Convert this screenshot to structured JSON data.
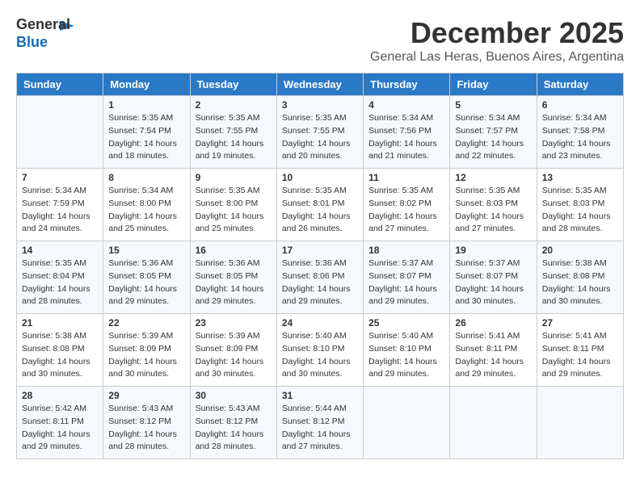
{
  "header": {
    "logo_line1": "General",
    "logo_line2": "Blue",
    "month": "December 2025",
    "location": "General Las Heras, Buenos Aires, Argentina"
  },
  "days_of_week": [
    "Sunday",
    "Monday",
    "Tuesday",
    "Wednesday",
    "Thursday",
    "Friday",
    "Saturday"
  ],
  "weeks": [
    [
      {
        "day": "",
        "content": ""
      },
      {
        "day": "1",
        "content": "Sunrise: 5:35 AM\nSunset: 7:54 PM\nDaylight: 14 hours\nand 18 minutes."
      },
      {
        "day": "2",
        "content": "Sunrise: 5:35 AM\nSunset: 7:55 PM\nDaylight: 14 hours\nand 19 minutes."
      },
      {
        "day": "3",
        "content": "Sunrise: 5:35 AM\nSunset: 7:55 PM\nDaylight: 14 hours\nand 20 minutes."
      },
      {
        "day": "4",
        "content": "Sunrise: 5:34 AM\nSunset: 7:56 PM\nDaylight: 14 hours\nand 21 minutes."
      },
      {
        "day": "5",
        "content": "Sunrise: 5:34 AM\nSunset: 7:57 PM\nDaylight: 14 hours\nand 22 minutes."
      },
      {
        "day": "6",
        "content": "Sunrise: 5:34 AM\nSunset: 7:58 PM\nDaylight: 14 hours\nand 23 minutes."
      }
    ],
    [
      {
        "day": "7",
        "content": "Sunrise: 5:34 AM\nSunset: 7:59 PM\nDaylight: 14 hours\nand 24 minutes."
      },
      {
        "day": "8",
        "content": "Sunrise: 5:34 AM\nSunset: 8:00 PM\nDaylight: 14 hours\nand 25 minutes."
      },
      {
        "day": "9",
        "content": "Sunrise: 5:35 AM\nSunset: 8:00 PM\nDaylight: 14 hours\nand 25 minutes."
      },
      {
        "day": "10",
        "content": "Sunrise: 5:35 AM\nSunset: 8:01 PM\nDaylight: 14 hours\nand 26 minutes."
      },
      {
        "day": "11",
        "content": "Sunrise: 5:35 AM\nSunset: 8:02 PM\nDaylight: 14 hours\nand 27 minutes."
      },
      {
        "day": "12",
        "content": "Sunrise: 5:35 AM\nSunset: 8:03 PM\nDaylight: 14 hours\nand 27 minutes."
      },
      {
        "day": "13",
        "content": "Sunrise: 5:35 AM\nSunset: 8:03 PM\nDaylight: 14 hours\nand 28 minutes."
      }
    ],
    [
      {
        "day": "14",
        "content": "Sunrise: 5:35 AM\nSunset: 8:04 PM\nDaylight: 14 hours\nand 28 minutes."
      },
      {
        "day": "15",
        "content": "Sunrise: 5:36 AM\nSunset: 8:05 PM\nDaylight: 14 hours\nand 29 minutes."
      },
      {
        "day": "16",
        "content": "Sunrise: 5:36 AM\nSunset: 8:05 PM\nDaylight: 14 hours\nand 29 minutes."
      },
      {
        "day": "17",
        "content": "Sunrise: 5:36 AM\nSunset: 8:06 PM\nDaylight: 14 hours\nand 29 minutes."
      },
      {
        "day": "18",
        "content": "Sunrise: 5:37 AM\nSunset: 8:07 PM\nDaylight: 14 hours\nand 29 minutes."
      },
      {
        "day": "19",
        "content": "Sunrise: 5:37 AM\nSunset: 8:07 PM\nDaylight: 14 hours\nand 30 minutes."
      },
      {
        "day": "20",
        "content": "Sunrise: 5:38 AM\nSunset: 8:08 PM\nDaylight: 14 hours\nand 30 minutes."
      }
    ],
    [
      {
        "day": "21",
        "content": "Sunrise: 5:38 AM\nSunset: 8:08 PM\nDaylight: 14 hours\nand 30 minutes."
      },
      {
        "day": "22",
        "content": "Sunrise: 5:39 AM\nSunset: 8:09 PM\nDaylight: 14 hours\nand 30 minutes."
      },
      {
        "day": "23",
        "content": "Sunrise: 5:39 AM\nSunset: 8:09 PM\nDaylight: 14 hours\nand 30 minutes."
      },
      {
        "day": "24",
        "content": "Sunrise: 5:40 AM\nSunset: 8:10 PM\nDaylight: 14 hours\nand 30 minutes."
      },
      {
        "day": "25",
        "content": "Sunrise: 5:40 AM\nSunset: 8:10 PM\nDaylight: 14 hours\nand 29 minutes."
      },
      {
        "day": "26",
        "content": "Sunrise: 5:41 AM\nSunset: 8:11 PM\nDaylight: 14 hours\nand 29 minutes."
      },
      {
        "day": "27",
        "content": "Sunrise: 5:41 AM\nSunset: 8:11 PM\nDaylight: 14 hours\nand 29 minutes."
      }
    ],
    [
      {
        "day": "28",
        "content": "Sunrise: 5:42 AM\nSunset: 8:11 PM\nDaylight: 14 hours\nand 29 minutes."
      },
      {
        "day": "29",
        "content": "Sunrise: 5:43 AM\nSunset: 8:12 PM\nDaylight: 14 hours\nand 28 minutes."
      },
      {
        "day": "30",
        "content": "Sunrise: 5:43 AM\nSunset: 8:12 PM\nDaylight: 14 hours\nand 28 minutes."
      },
      {
        "day": "31",
        "content": "Sunrise: 5:44 AM\nSunset: 8:12 PM\nDaylight: 14 hours\nand 27 minutes."
      },
      {
        "day": "",
        "content": ""
      },
      {
        "day": "",
        "content": ""
      },
      {
        "day": "",
        "content": ""
      }
    ]
  ]
}
